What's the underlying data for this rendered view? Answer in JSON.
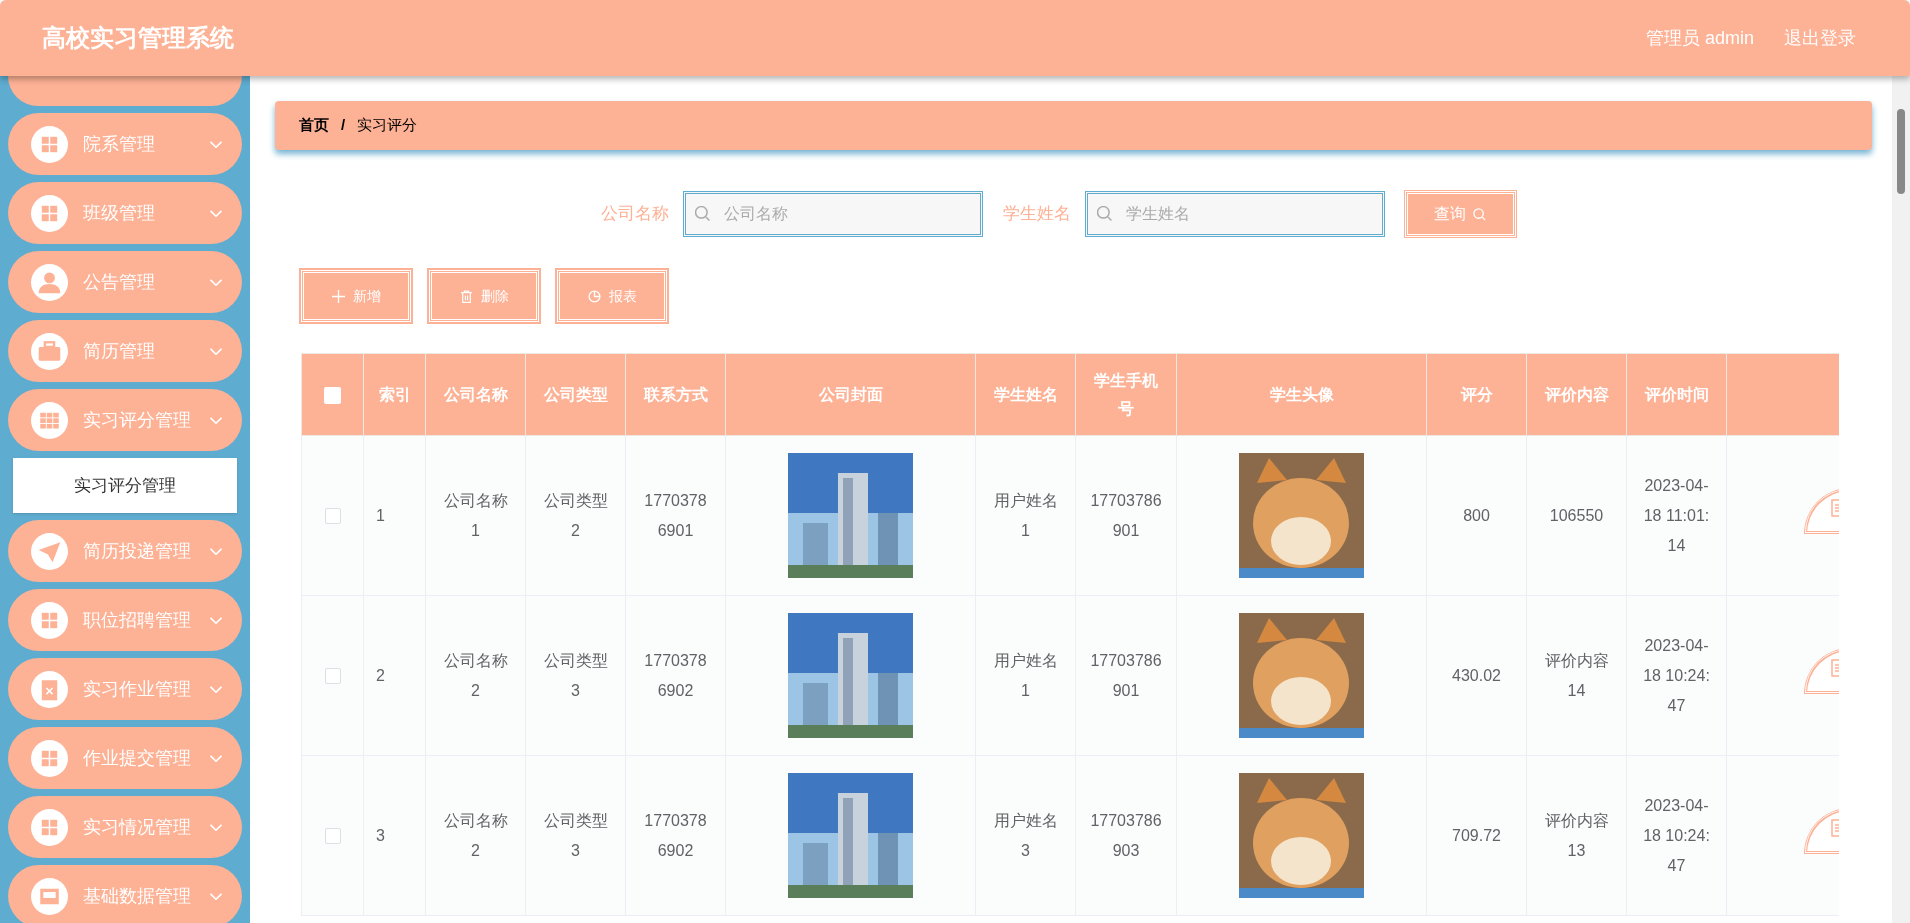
{
  "header": {
    "title": "高校实习管理系统",
    "user": "管理员 admin",
    "logout": "退出登录"
  },
  "sidebar": {
    "items": [
      {
        "label": "院系管理"
      },
      {
        "label": "班级管理"
      },
      {
        "label": "公告管理"
      },
      {
        "label": "简历管理"
      },
      {
        "label": "实习评分管理",
        "children": [
          {
            "label": "实习评分管理",
            "selected": true
          }
        ]
      },
      {
        "label": "简历投递管理"
      },
      {
        "label": "职位招聘管理"
      },
      {
        "label": "实习作业管理"
      },
      {
        "label": "作业提交管理"
      },
      {
        "label": "实习情况管理"
      },
      {
        "label": "基础数据管理"
      }
    ]
  },
  "breadcrumb": {
    "separator": "/",
    "items": [
      "首页",
      "实习评分"
    ]
  },
  "search": {
    "fields": [
      {
        "label": "公司名称",
        "placeholder": "公司名称"
      },
      {
        "label": "学生姓名",
        "placeholder": "学生姓名"
      }
    ],
    "button": "查询"
  },
  "actions": [
    {
      "kind": "add",
      "label": "新增"
    },
    {
      "kind": "delete",
      "label": "删除"
    },
    {
      "kind": "report",
      "label": "报表"
    }
  ],
  "table": {
    "select_all": {
      "checked": false
    },
    "columns": [
      "索引",
      "公司名称",
      "公司类型",
      "联系方式",
      "公司封面",
      "学生姓名",
      "学生手机号",
      "学生头像",
      "评分",
      "评价内容",
      "评价时间"
    ],
    "rows": [
      {
        "checked": false,
        "cells": [
          "1",
          "公司名称1",
          "公司类型2",
          "17703786901",
          {
            "kind": "picture"
          },
          "用户姓名1",
          "17703786901",
          {
            "kind": "picture"
          },
          "800",
          "106550",
          "2023-04-18 11:01:14"
        ]
      },
      {
        "checked": false,
        "cells": [
          "2",
          "公司名称2",
          "公司类型3",
          "17703786902",
          {
            "kind": "picture"
          },
          "用户姓名1",
          "17703786901",
          {
            "kind": "picture"
          },
          "430.02",
          "评价内容14",
          "2023-04-18 10:24:47"
        ]
      },
      {
        "checked": false,
        "cells": [
          "3",
          "公司名称2",
          "公司类型3",
          "17703786902",
          {
            "kind": "picture"
          },
          "用户姓名3",
          "17703786903",
          {
            "kind": "picture"
          },
          "709.72",
          "评价内容13",
          "2023-04-18 10:24:47"
        ]
      }
    ]
  }
}
